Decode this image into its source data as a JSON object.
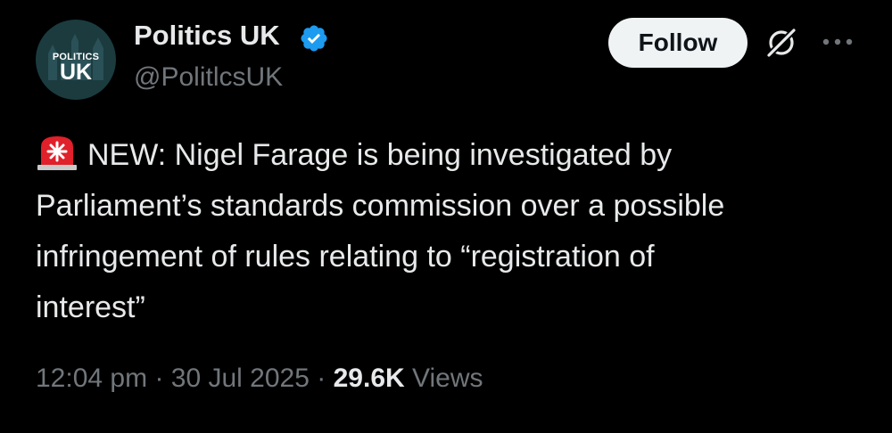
{
  "account": {
    "avatar_text_top": "POLITICS",
    "avatar_text_main": "UK",
    "display_name": "Politics UK",
    "handle": "@PolitlcsUK",
    "verified_icon": "verified-badge-icon"
  },
  "header": {
    "follow_label": "Follow",
    "grok_icon": "grok-icon",
    "more_icon": "more-icon"
  },
  "tweet": {
    "emoji_icon": "police-siren-icon",
    "line1": "NEW: Nigel Farage is being investigated by",
    "line2": "Parliament’s standards commission over a possible",
    "line3": "infringement of rules relating to “registration of",
    "line4": "interest”"
  },
  "meta": {
    "time": "12:04 pm",
    "separator": "·",
    "date": "30 Jul 2025",
    "views_count": "29.6K",
    "views_label": "Views"
  },
  "colors": {
    "background": "#000000",
    "text_primary": "#e7e9ea",
    "text_secondary": "#71767b",
    "verified_blue": "#1d9bf0",
    "follow_button_bg": "#eff3f4",
    "siren_red": "#e0202a"
  }
}
